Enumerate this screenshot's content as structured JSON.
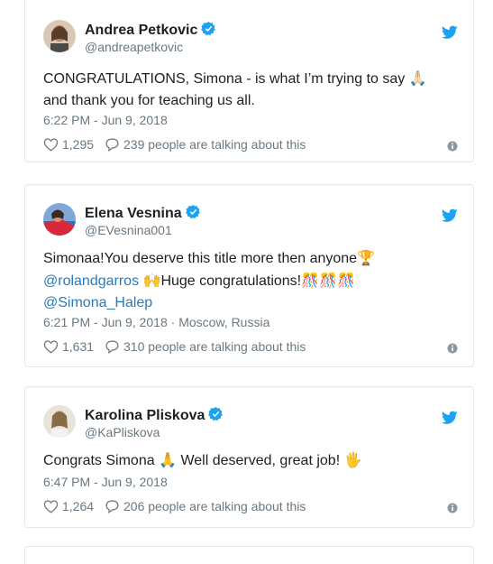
{
  "colors": {
    "link": "#2b7bb9",
    "verified": "#1da1f2",
    "muted": "#697882",
    "border": "#e1e8ed"
  },
  "tweets": [
    {
      "name": "Andrea Petkovic",
      "handle": "@andreapetkovic",
      "text_line1": "CONGRATULATIONS, Simona - is what I’m trying to say",
      "emoji1": "🙏🏻",
      "text_line2": "and thank you for teaching us all.",
      "time": "6:22 PM - Jun 9, 2018",
      "likes": "1,295",
      "talking": "239 people are talking about this"
    },
    {
      "name": "Elena Vesnina",
      "handle": "@EVesnina001",
      "text_part1": "Simonaa!You deserve this title more then anyone",
      "emoji_trophy": "🏆",
      "mention1": "@rolandgarros",
      "emoji_hands": "🙌",
      "text_part2": "Huge congratulations!",
      "emoji_party": "🎊🎊🎊",
      "mention2": "@Simona_Halep",
      "time": "6:21 PM - Jun 9, 2018",
      "location": "Moscow, Russia",
      "likes": "1,631",
      "talking": "310 people are talking about this"
    },
    {
      "name": "Karolina Pliskova",
      "handle": "@KaPliskova",
      "text_part1": "Congrats Simona",
      "emoji_pray": "🙏",
      "text_part2": "Well deserved, great job!",
      "emoji_wave": "🖐",
      "time": "6:47 PM - Jun 9, 2018",
      "likes": "1,264",
      "talking": "206 people are talking about this"
    }
  ]
}
